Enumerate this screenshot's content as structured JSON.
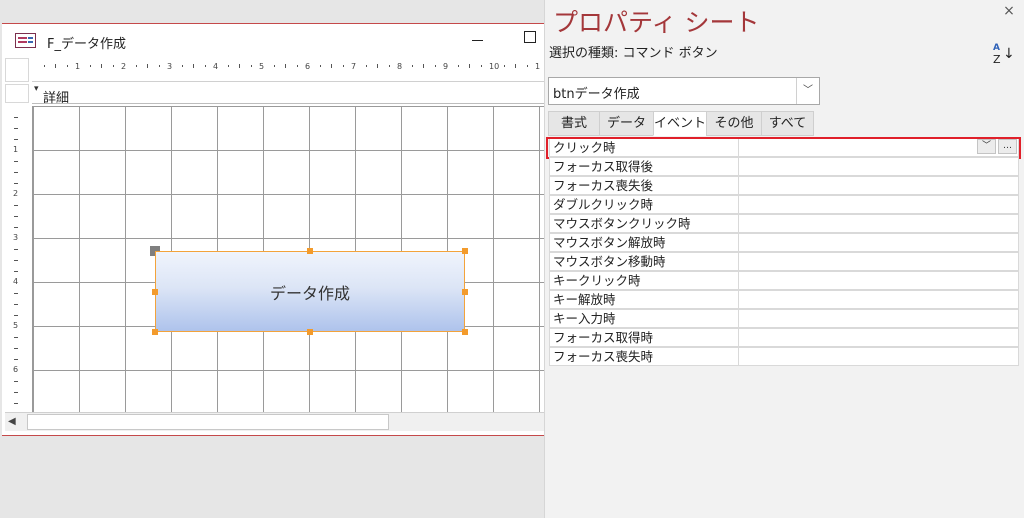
{
  "form": {
    "title": "F_データ作成",
    "section_label": "詳細",
    "button_caption": "データ作成",
    "h_ruler_numbers": [
      "1",
      "2",
      "3",
      "4",
      "5",
      "6",
      "7",
      "8",
      "9",
      "10",
      "1"
    ],
    "v_ruler_numbers": [
      "1",
      "2",
      "3",
      "4",
      "5",
      "6"
    ]
  },
  "property_sheet": {
    "title": "プロパティ シート",
    "close_glyph": "×",
    "selection_type": "選択の種類: コマンド ボタン",
    "sort_icon": "sort-az-icon",
    "object_name": "btnデータ作成",
    "dropdown_glyph": "﹀",
    "tabs": [
      "書式",
      "データ",
      "イベント",
      "その他",
      "すべて"
    ],
    "active_tab": "イベント",
    "properties": [
      "クリック時",
      "フォーカス取得後",
      "フォーカス喪失後",
      "ダブルクリック時",
      "マウスボタンクリック時",
      "マウスボタン解放時",
      "マウスボタン移動時",
      "キークリック時",
      "キー解放時",
      "キー入力時",
      "フォーカス取得時",
      "フォーカス喪失時"
    ],
    "row_dropdown_glyph": "﹀",
    "row_builder_glyph": "…",
    "highlight_color": "#e0202a"
  },
  "colors": {
    "title_accent": "#a4373a",
    "selection_handle": "#f39b2c",
    "button_gradient_top": "#f0f4fc",
    "button_gradient_bottom": "#aec3ec"
  }
}
